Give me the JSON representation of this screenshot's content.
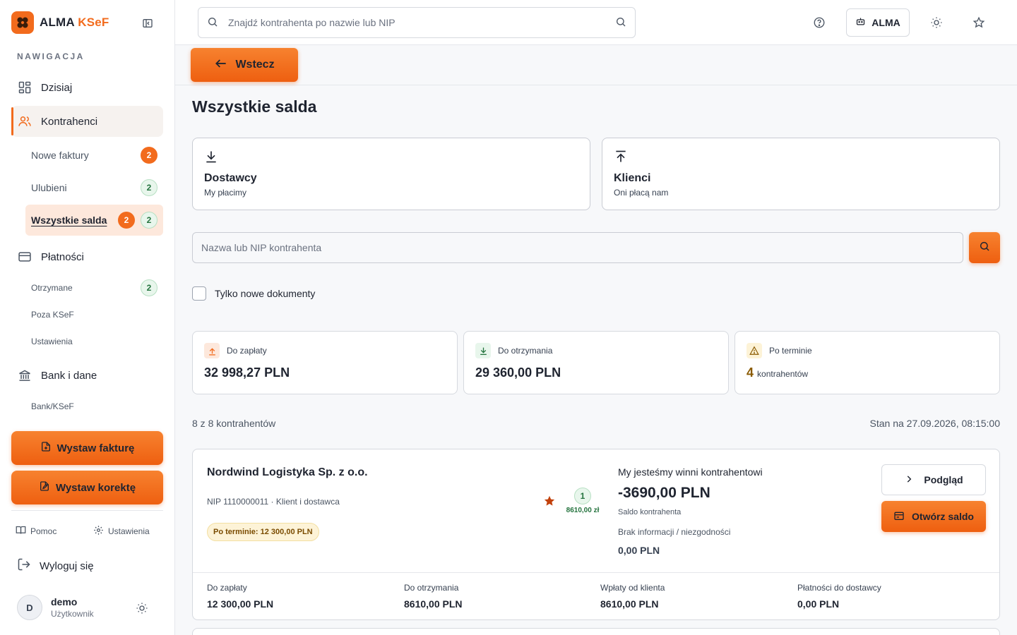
{
  "brand": {
    "name": "ALMA",
    "accent": "KSeF",
    "accent_color": "#f26b1d"
  },
  "sidebar": {
    "heading": "NAWIGACJA",
    "items": [
      {
        "label": "Dzisiaj",
        "icon": "dashboard-icon"
      },
      {
        "label": "Kontrahenci",
        "icon": "users-icon",
        "active": true
      },
      {
        "label": "Płatności",
        "icon": "card-icon"
      },
      {
        "label": "Bank i dane",
        "icon": "bank-icon"
      }
    ],
    "kontrahenci_sub": [
      {
        "label": "Nowe faktury",
        "badge_orange": "2"
      },
      {
        "label": "Ulubieni",
        "badge_green": "2"
      },
      {
        "label": "Wszystkie salda",
        "badge_orange": "2",
        "badge_green": "2",
        "active": true
      }
    ],
    "platnosci_sub": [
      {
        "label": "Otrzymane",
        "badge_green": "2"
      },
      {
        "label": "Poza KSeF"
      },
      {
        "label": "Ustawienia"
      }
    ],
    "bank_sub": [
      {
        "label": "Bank/KSeF"
      }
    ],
    "cta_invoice": "Wystaw fakturę",
    "cta_correction": "Wystaw korektę",
    "help": "Pomoc",
    "settings": "Ustawienia",
    "logout": "Wyloguj się",
    "user": {
      "initial": "D",
      "name": "demo",
      "role": "Użytkownik"
    }
  },
  "topbar": {
    "search_placeholder": "Znajdź kontrahenta po nazwie lub NIP",
    "org_label": "ALMA"
  },
  "back_label": "Wstecz",
  "page_title": "Wszystkie salda",
  "direction_cards": [
    {
      "title": "Dostawcy",
      "subtitle": "My płacimy",
      "icon": "arrow-down-icon"
    },
    {
      "title": "Klienci",
      "subtitle": "Oni płacą nam",
      "icon": "arrow-up-icon"
    }
  ],
  "filter": {
    "placeholder": "Nazwa lub NIP kontrahenta",
    "checkbox_label": "Tylko nowe dokumenty",
    "checked": false
  },
  "stats": [
    {
      "label": "Do zapłaty",
      "value": "32 998,27 PLN",
      "icon": "arrow-up-icon",
      "tone": "#fde8dc"
    },
    {
      "label": "Do otrzymania",
      "value": "29 360,00 PLN",
      "icon": "arrow-down-icon",
      "tone": "#e8f6ec"
    },
    {
      "label": "Po terminie",
      "value_num": "4",
      "value_unit": "kontrahentów",
      "icon": "warning-icon",
      "tone": "#fdf3d7"
    }
  ],
  "list_meta": {
    "count": "8 z 8 kontrahentów",
    "stamp": "Stan na 27.09.2026, 08:15:00"
  },
  "contractor": {
    "name": "Nordwind Logistyka Sp. z o.o.",
    "nip_line": "NIP 1110000011 · Klient i dostawca",
    "overdue_tag": "Po terminie: 12 300,00 PLN",
    "mini_count": "1",
    "mini_amount": "8610,00 zł",
    "owe_label": "My jesteśmy winni kontrahentowi",
    "balance": "-3690,00 PLN",
    "balance_label": "Saldo kontrahenta",
    "info_label": "Brak informacji / niezgodności",
    "info_value": "0,00 PLN",
    "preview_label": "Podgląd",
    "open_label": "Otwórz saldo",
    "footer": [
      {
        "label": "Do zapłaty",
        "value": "12 300,00 PLN"
      },
      {
        "label": "Do otrzymania",
        "value": "8610,00 PLN"
      },
      {
        "label": "Wpłaty od klienta",
        "value": "8610,00 PLN"
      },
      {
        "label": "Płatności do dostawcy",
        "value": "0,00 PLN"
      }
    ]
  }
}
